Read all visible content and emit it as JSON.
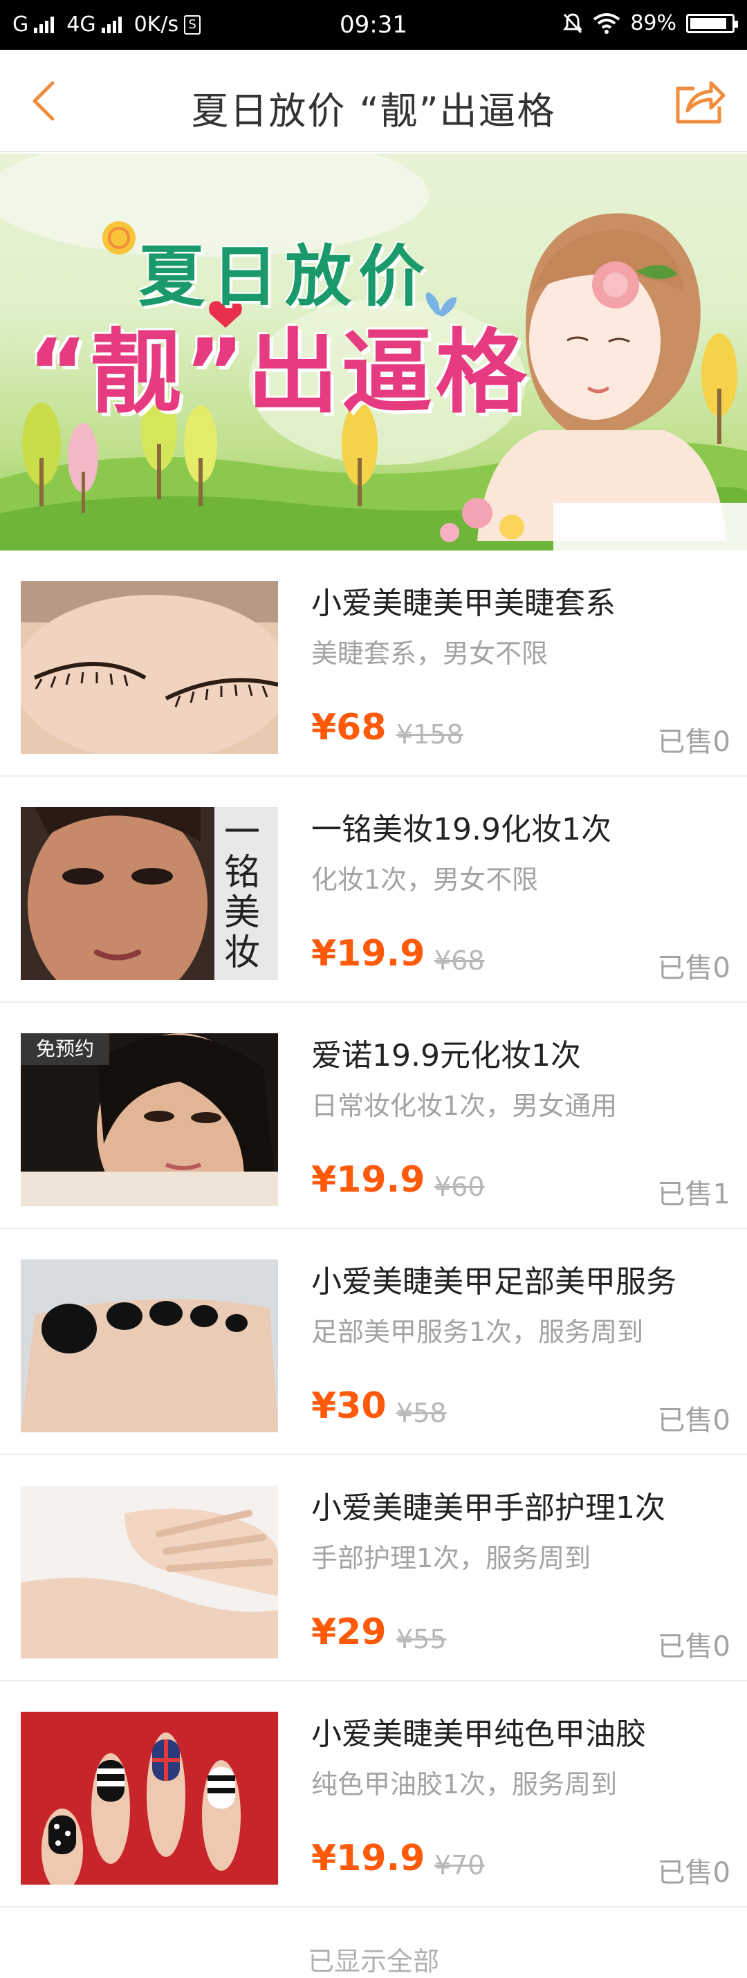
{
  "status_bar": {
    "carrier": "G",
    "network": "4G",
    "speed": "0K/s",
    "time": "09:31",
    "battery": "89%",
    "battery_level": 0.89
  },
  "nav": {
    "title": "夏日放价 “靓”出逼格"
  },
  "banner": {
    "line1": "夏日放价",
    "line2": "“靓”出逼格"
  },
  "items": [
    {
      "title": "小爱美睫美甲美睫套系",
      "desc": "美睫套系，男女不限",
      "price": "¥68",
      "original": "¥158",
      "sold": "已售0",
      "badge": ""
    },
    {
      "title": "一铭美妆19.9化妆1次",
      "desc": "化妆1次，男女不限",
      "price": "¥19.9",
      "original": "¥68",
      "sold": "已售0",
      "badge": "",
      "thumb_text": "一铭美妆"
    },
    {
      "title": "爱诺19.9元化妆1次",
      "desc": "日常妆化妆1次，男女通用",
      "price": "¥19.9",
      "original": "¥60",
      "sold": "已售1",
      "badge": "免预约"
    },
    {
      "title": "小爱美睫美甲足部美甲服务",
      "desc": "足部美甲服务1次，服务周到",
      "price": "¥30",
      "original": "¥58",
      "sold": "已售0",
      "badge": ""
    },
    {
      "title": "小爱美睫美甲手部护理1次",
      "desc": "手部护理1次，服务周到",
      "price": "¥29",
      "original": "¥55",
      "sold": "已售0",
      "badge": ""
    },
    {
      "title": "小爱美睫美甲纯色甲油胶",
      "desc": "纯色甲油胶1次，服务周到",
      "price": "¥19.9",
      "original": "¥70",
      "sold": "已售0",
      "badge": ""
    }
  ],
  "footer": {
    "text": "已显示全部"
  },
  "colors": {
    "accent": "#ff5a0a",
    "nav_icon": "#f08c3c"
  }
}
